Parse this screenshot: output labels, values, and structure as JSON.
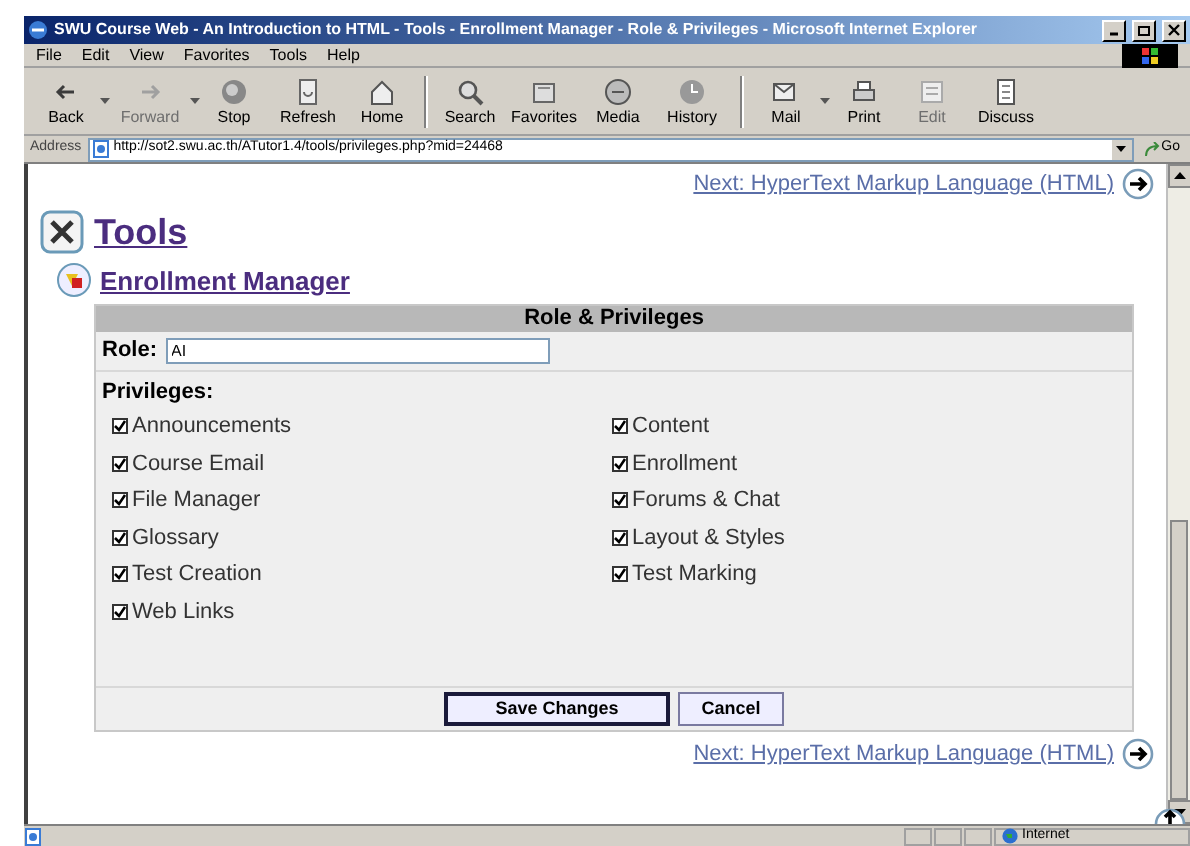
{
  "window": {
    "title": "SWU Course Web - An Introduction to HTML - Tools - Enrollment Manager - Role & Privileges - Microsoft Internet Explorer"
  },
  "menu": [
    "File",
    "Edit",
    "View",
    "Favorites",
    "Tools",
    "Help"
  ],
  "toolbar": [
    {
      "label": "Back",
      "disabled": false
    },
    {
      "label": "Forward",
      "disabled": true
    },
    {
      "label": "Stop",
      "disabled": false
    },
    {
      "label": "Refresh",
      "disabled": false
    },
    {
      "label": "Home",
      "disabled": false
    },
    {
      "label": "Search",
      "disabled": false
    },
    {
      "label": "Favorites",
      "disabled": false
    },
    {
      "label": "Media",
      "disabled": false
    },
    {
      "label": "History",
      "disabled": false
    },
    {
      "label": "Mail",
      "disabled": false
    },
    {
      "label": "Print",
      "disabled": false
    },
    {
      "label": "Edit",
      "disabled": true
    },
    {
      "label": "Discuss",
      "disabled": false
    }
  ],
  "address": {
    "label": "Address",
    "value": "http://sot2.swu.ac.th/ATutor1.4/tools/privileges.php?mid=24468",
    "go": "Go"
  },
  "page": {
    "next_top": "Next: HyperText Markup Language (HTML)",
    "heading": "Tools",
    "subheading": "Enrollment Manager",
    "panel": {
      "title": "Role & Privileges",
      "role_label": "Role:",
      "role_value": "AI",
      "privileges_label": "Privileges:",
      "privileges": [
        {
          "label": "Announcements",
          "checked": true
        },
        {
          "label": "Content",
          "checked": true
        },
        {
          "label": "Course Email",
          "checked": true
        },
        {
          "label": "Enrollment",
          "checked": true
        },
        {
          "label": "File Manager",
          "checked": true
        },
        {
          "label": "Forums & Chat",
          "checked": true
        },
        {
          "label": "Glossary",
          "checked": true
        },
        {
          "label": "Layout & Styles",
          "checked": true
        },
        {
          "label": "Test Creation",
          "checked": true
        },
        {
          "label": "Test Marking",
          "checked": true
        },
        {
          "label": "Web Links",
          "checked": true
        }
      ],
      "buttons": [
        "Save Changes",
        "Cancel"
      ]
    },
    "next_bottom": "Next: HyperText Markup Language (HTML)"
  },
  "status_bar": {
    "zone": "Internet"
  }
}
